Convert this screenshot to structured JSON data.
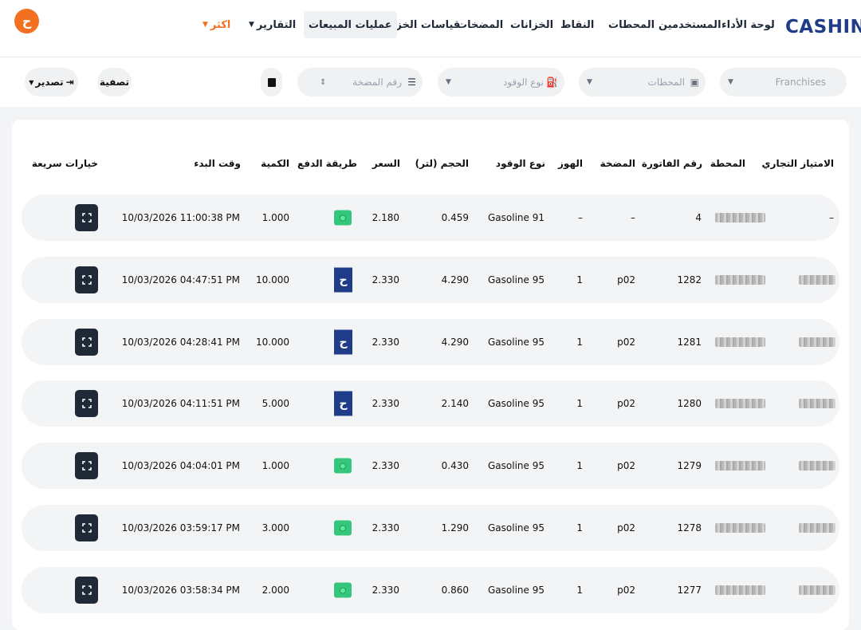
{
  "app": {
    "logo": "CASHIN",
    "avatar_letter": "ح"
  },
  "nav": {
    "items": [
      "لوحة الأداء",
      "المستخدمين",
      "المحطات",
      "النقاط",
      "الخزانات",
      "المضخات",
      "قياسات الخزان",
      "عمليات المبيعات",
      "التقارير",
      "اكثر"
    ],
    "active": "عمليات المبيعات"
  },
  "filters": {
    "franchises": "Franchises",
    "stations": "المحطات",
    "fuel_type": "نوع الوقود",
    "pump_number": "رقم المضخة",
    "filter_button": "تصفية",
    "export_button": "تصدير"
  },
  "table": {
    "headers": [
      "الامتياز التجاري",
      "المحطة",
      "رقم الفاتورة",
      "المضخة",
      "الهوز",
      "نوع الوقود",
      "الحجم (لتر)",
      "السعر",
      "طريقة الدفع",
      "الكمية",
      "وقت البدء",
      "خيارات سريعة"
    ],
    "rows": [
      {
        "franchise": "–",
        "invoice": "4",
        "pump": "–",
        "hose": "–",
        "fuel": "Gasoline 91",
        "volume": "0.459",
        "price": "2.180",
        "payment": "cash",
        "quantity": "1.000",
        "start": "10/03/2026 11:00:38 PM"
      },
      {
        "franchise": "",
        "invoice": "1282",
        "pump": "p02",
        "hose": "1",
        "fuel": "Gasoline 95",
        "volume": "4.290",
        "price": "2.330",
        "payment": "cashin",
        "quantity": "10.000",
        "start": "10/03/2026 04:47:51 PM"
      },
      {
        "franchise": "",
        "invoice": "1281",
        "pump": "p02",
        "hose": "1",
        "fuel": "Gasoline 95",
        "volume": "4.290",
        "price": "2.330",
        "payment": "cashin",
        "quantity": "10.000",
        "start": "10/03/2026 04:28:41 PM"
      },
      {
        "franchise": "",
        "invoice": "1280",
        "pump": "p02",
        "hose": "1",
        "fuel": "Gasoline 95",
        "volume": "2.140",
        "price": "2.330",
        "payment": "cashin",
        "quantity": "5.000",
        "start": "10/03/2026 04:11:51 PM"
      },
      {
        "franchise": "",
        "invoice": "1279",
        "pump": "p02",
        "hose": "1",
        "fuel": "Gasoline 95",
        "volume": "0.430",
        "price": "2.330",
        "payment": "cash",
        "quantity": "1.000",
        "start": "10/03/2026 04:04:01 PM"
      },
      {
        "franchise": "",
        "invoice": "1278",
        "pump": "p02",
        "hose": "1",
        "fuel": "Gasoline 95",
        "volume": "1.290",
        "price": "2.330",
        "payment": "cash",
        "quantity": "3.000",
        "start": "10/03/2026 03:59:17 PM"
      },
      {
        "franchise": "",
        "invoice": "1277",
        "pump": "p02",
        "hose": "1",
        "fuel": "Gasoline 95",
        "volume": "0.860",
        "price": "2.330",
        "payment": "cash",
        "quantity": "2.000",
        "start": "10/03/2026 03:58:34 PM"
      }
    ]
  },
  "colors": {
    "brand": "#1f3c88",
    "accent": "#f37021",
    "cash": "#34c77b",
    "dark_button": "#1f2937"
  },
  "icons": {
    "fuel": "fuel-pump-icon",
    "station": "station-icon",
    "pump": "list-icon",
    "calendar": "calendar-icon",
    "export": "export-icon",
    "quick": "expand-icon"
  }
}
